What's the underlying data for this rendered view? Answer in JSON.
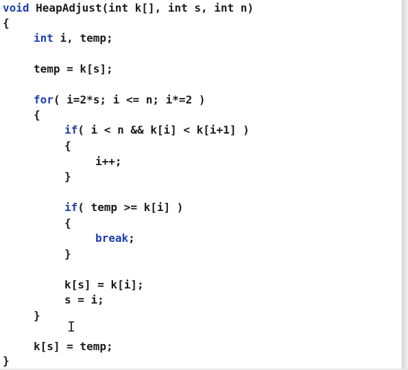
{
  "code": {
    "lines": [
      {
        "kw": "void",
        "rest": " HeapAdjust(int k[], int s, int n)"
      },
      {
        "kw": "",
        "rest": "{"
      },
      {
        "kw": "int",
        "rest": " i, temp;"
      },
      {
        "kw": "",
        "rest": "temp = k[s];"
      },
      {
        "kw": "for",
        "rest": "( i=2*s; i <= n; i*=2 )"
      },
      {
        "kw": "",
        "rest": "{"
      },
      {
        "kw": "if",
        "rest": "( i < n && k[i] < k[i+1] )"
      },
      {
        "kw": "",
        "rest": "{"
      },
      {
        "kw": "",
        "rest": "i++;"
      },
      {
        "kw": "",
        "rest": "}"
      },
      {
        "kw": "if",
        "rest": "( temp >= k[i] )"
      },
      {
        "kw": "",
        "rest": "{"
      },
      {
        "kw": "break",
        "rest": ";"
      },
      {
        "kw": "",
        "rest": "}"
      },
      {
        "kw": "",
        "rest": "k[s] = k[i];"
      },
      {
        "kw": "",
        "rest": "s = i;"
      },
      {
        "kw": "",
        "rest": "}"
      },
      {
        "kw": "",
        "rest": "k[s] = temp;"
      },
      {
        "kw": "",
        "rest": "}"
      }
    ]
  },
  "cursor_glyph": "I",
  "colors": {
    "keyword": "#1b3fb0",
    "text": "#1a1a1a",
    "background": "#ffffff"
  }
}
